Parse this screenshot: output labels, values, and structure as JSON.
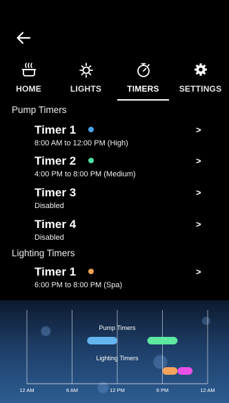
{
  "tabs": [
    {
      "label": "HOME",
      "icon": "spa-tub-icon"
    },
    {
      "label": "LIGHTS",
      "icon": "light-bulb-icon"
    },
    {
      "label": "TIMERS",
      "icon": "stopwatch-icon",
      "active": true
    },
    {
      "label": "SETTINGS",
      "icon": "gear-icon"
    }
  ],
  "pump_section": {
    "title": "Pump Timers",
    "timers": [
      {
        "name": "Timer 1",
        "detail": "8:00 AM to 12:00 PM (High)",
        "dot_color": "#4aa3ee",
        "chevron": ">"
      },
      {
        "name": "Timer 2",
        "detail": "4:00 PM to 8:00 PM (Medium)",
        "dot_color": "#4de0a0",
        "chevron": ">"
      },
      {
        "name": "Timer 3",
        "detail": "Disabled",
        "dot_color": "",
        "chevron": ">"
      },
      {
        "name": "Timer 4",
        "detail": "Disabled",
        "dot_color": "",
        "chevron": ">"
      }
    ]
  },
  "lighting_section": {
    "title": "Lighting Timers",
    "timers": [
      {
        "name": "Timer 1",
        "detail": "6:00 PM to 8:00 PM (Spa)",
        "dot_color": "#f0a050",
        "chevron": ">"
      }
    ]
  },
  "timeline": {
    "pump_label": "Pump Timers",
    "lighting_label": "Lighting Timers",
    "ticks": [
      "12 AM",
      "6 AM",
      "12 PM",
      "6 PM",
      "12 AM"
    ],
    "x_range_hours": [
      0,
      24
    ],
    "pump_bars": [
      {
        "start": 8,
        "end": 12,
        "color": "#64b4f0"
      },
      {
        "start": 16,
        "end": 20,
        "color": "#5ee8a0"
      }
    ],
    "lighting_bars": [
      {
        "start": 18,
        "end": 20,
        "color": "#f5a45a"
      },
      {
        "start": 20,
        "end": 22,
        "color": "#e850e6"
      }
    ]
  }
}
